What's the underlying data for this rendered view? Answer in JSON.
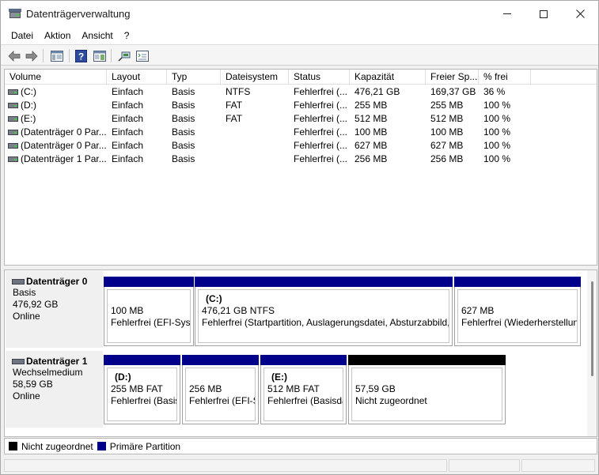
{
  "window": {
    "title": "Datenträgerverwaltung"
  },
  "menu": [
    "Datei",
    "Aktion",
    "Ansicht",
    "?"
  ],
  "toolbar": {
    "buttons": [
      "back-arrow-icon",
      "forward-arrow-icon",
      "console-tree-icon",
      "help-icon",
      "show-pane-icon",
      "rescan-icon",
      "properties-icon"
    ]
  },
  "volume_list": {
    "columns": [
      "Volume",
      "Layout",
      "Typ",
      "Dateisystem",
      "Status",
      "Kapazität",
      "Freier Sp...",
      "% frei"
    ],
    "rows": [
      [
        "(C:)",
        "Einfach",
        "Basis",
        "NTFS",
        "Fehlerfrei (...",
        "476,21 GB",
        "169,37 GB",
        "36 %"
      ],
      [
        "(D:)",
        "Einfach",
        "Basis",
        "FAT",
        "Fehlerfrei (...",
        "255 MB",
        "255 MB",
        "100 %"
      ],
      [
        "(E:)",
        "Einfach",
        "Basis",
        "FAT",
        "Fehlerfrei (...",
        "512 MB",
        "512 MB",
        "100 %"
      ],
      [
        "(Datenträger 0 Par...",
        "Einfach",
        "Basis",
        "",
        "Fehlerfrei (...",
        "100 MB",
        "100 MB",
        "100 %"
      ],
      [
        "(Datenträger 0 Par...",
        "Einfach",
        "Basis",
        "",
        "Fehlerfrei (...",
        "627 MB",
        "627 MB",
        "100 %"
      ],
      [
        "(Datenträger 1 Par...",
        "Einfach",
        "Basis",
        "",
        "Fehlerfrei (...",
        "256 MB",
        "256 MB",
        "100 %"
      ]
    ]
  },
  "disks": [
    {
      "name": "Datenträger 0",
      "type": "Basis",
      "size": "476,92 GB",
      "state": "Online",
      "partitions": [
        {
          "letter": "",
          "size": "100 MB",
          "status": "Fehlerfrei (EFI-Systempartition)",
          "kind": "primary"
        },
        {
          "letter": "(C:)",
          "size": "476,21 GB NTFS",
          "status": "Fehlerfrei (Startpartition, Auslagerungsdatei, Absturzabbild, Primäre Partition)",
          "kind": "primary"
        },
        {
          "letter": "",
          "size": "627 MB",
          "status": "Fehlerfrei (Wiederherstellungspartition)",
          "kind": "primary"
        }
      ]
    },
    {
      "name": "Datenträger 1",
      "type": "Wechselmedium",
      "size": "58,59 GB",
      "state": "Online",
      "partitions": [
        {
          "letter": "(D:)",
          "size": "255 MB FAT",
          "status": "Fehlerfrei (Basisdatenpartition)",
          "kind": "primary"
        },
        {
          "letter": "",
          "size": "256 MB",
          "status": "Fehlerfrei (EFI-Systempartition)",
          "kind": "primary"
        },
        {
          "letter": "(E:)",
          "size": "512 MB FAT",
          "status": "Fehlerfrei (Basisdatenpartition)",
          "kind": "primary"
        },
        {
          "letter": "",
          "size": "57,59 GB",
          "status": "Nicht zugeordnet",
          "kind": "unallocated"
        }
      ]
    }
  ],
  "legend": [
    {
      "label": "Nicht zugeordnet",
      "color": "#000000"
    },
    {
      "label": "Primäre Partition",
      "color": "#00008b"
    }
  ],
  "colors": {
    "primary_partition": "#00008b",
    "unallocated": "#000000"
  }
}
